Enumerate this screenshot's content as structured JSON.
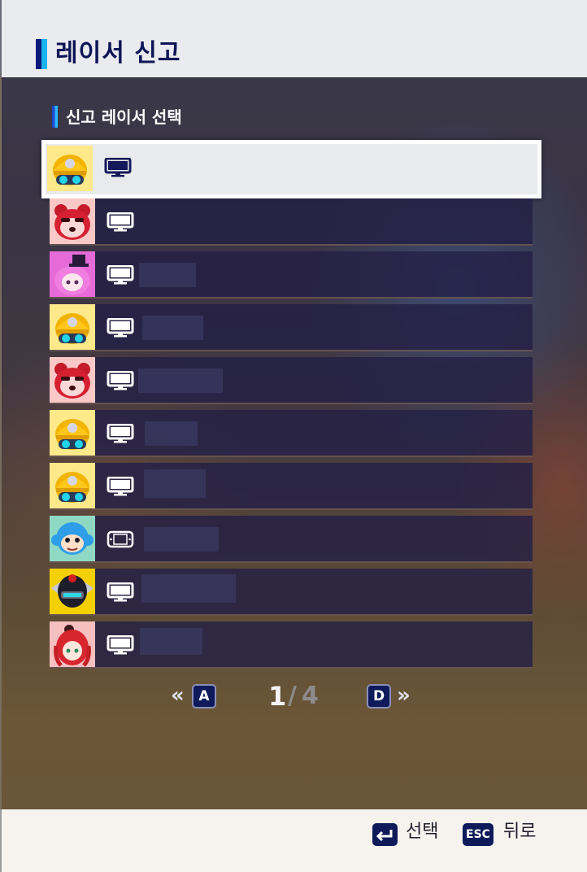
{
  "header": {
    "title": "레이서 신고"
  },
  "section": {
    "title": "신고 레이서 선택"
  },
  "racers": [
    {
      "avatar": "hardhat-helmet",
      "bg": "#fde98a",
      "platform": "pc-monitor-icon",
      "name": "",
      "selected": true
    },
    {
      "avatar": "red-panda",
      "bg": "#fbc8c8",
      "platform": "pc-monitor-icon",
      "name": ""
    },
    {
      "avatar": "pink-hair-tophat",
      "bg": "#e66ad8",
      "platform": "pc-monitor-icon",
      "name": ""
    },
    {
      "avatar": "hardhat-helmet",
      "bg": "#fde98a",
      "platform": "pc-monitor-icon",
      "name": ""
    },
    {
      "avatar": "red-panda",
      "bg": "#fbc8c8",
      "platform": "pc-monitor-icon",
      "name": ""
    },
    {
      "avatar": "hardhat-helmet",
      "bg": "#fde98a",
      "platform": "pc-monitor-icon",
      "name": ""
    },
    {
      "avatar": "hardhat-helmet",
      "bg": "#fde98a",
      "platform": "pc-monitor-icon",
      "name": ""
    },
    {
      "avatar": "blue-monkey",
      "bg": "#8fd9c4",
      "platform": "handheld-console-icon",
      "name": ""
    },
    {
      "avatar": "black-winged-helmet",
      "bg": "#f4d000",
      "platform": "pc-monitor-icon",
      "name": ""
    },
    {
      "avatar": "red-hair-girl",
      "bg": "#f6c0c0",
      "platform": "pc-monitor-icon",
      "name": ""
    }
  ],
  "pagination": {
    "prev_key": "A",
    "next_key": "D",
    "current": "1",
    "separator": "/",
    "total": "4"
  },
  "footer": {
    "select_key": "enter-icon",
    "select_label": "선택",
    "back_key": "ESC",
    "back_label": "뒤로"
  }
}
